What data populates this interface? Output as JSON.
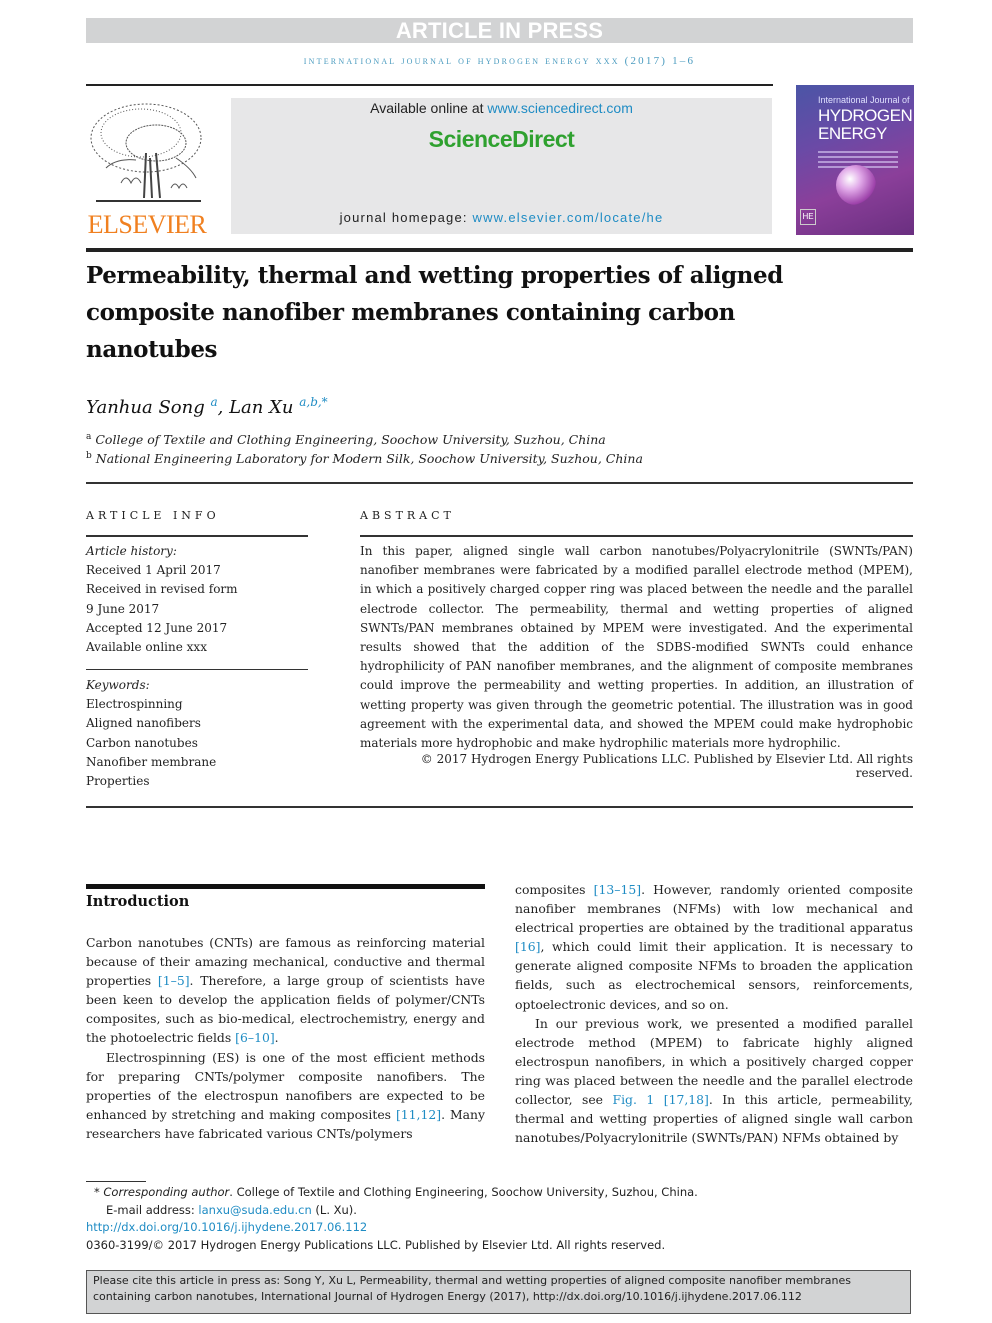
{
  "header": {
    "article_in_press": "ARTICLE IN PRESS",
    "journal_line": "International Journal of Hydrogen Energy xxx (2017) 1–6",
    "publisher_name": "ELSEVIER",
    "available_prefix": "Available online at ",
    "available_link": "www.sciencedirect.com",
    "brand": "ScienceDirect",
    "homepage_prefix": "journal homepage: ",
    "homepage_link": "www.elsevier.com/locate/he",
    "cover": {
      "title_small": "International Journal of",
      "title_line1": "HYDROGEN",
      "title_line2": "ENERGY",
      "badge": "HE"
    }
  },
  "article": {
    "title": "Permeability, thermal and wetting properties of aligned composite nanofiber membranes containing carbon nanotubes",
    "authors": [
      {
        "name": "Yanhua Song",
        "sup": "a"
      },
      {
        "name": "Lan Xu",
        "sup": "a,b,*"
      }
    ],
    "author_separator": ", ",
    "affiliations": [
      {
        "sup": "a",
        "text": "College of Textile and Clothing Engineering, Soochow University, Suzhou, China"
      },
      {
        "sup": "b",
        "text": "National Engineering Laboratory for Modern Silk, Soochow University, Suzhou, China"
      }
    ]
  },
  "article_info": {
    "label": "ARTICLE INFO",
    "history_label": "Article history:",
    "history": [
      "Received 1 April 2017",
      "Received in revised form",
      "9 June 2017",
      "Accepted 12 June 2017",
      "Available online xxx"
    ],
    "keywords_label": "Keywords:",
    "keywords": [
      "Electrospinning",
      "Aligned nanofibers",
      "Carbon nanotubes",
      "Nanofiber membrane",
      "Properties"
    ]
  },
  "abstract": {
    "label": "ABSTRACT",
    "text": "In this paper, aligned single wall carbon nanotubes/Polyacrylonitrile (SWNTs/PAN) nanofiber membranes were fabricated by a modified parallel electrode method (MPEM), in which a positively charged copper ring was placed between the needle and the parallel electrode collector. The permeability, thermal and wetting properties of aligned SWNTs/PAN membranes obtained by MPEM were investigated. And the experimental results showed that the addition of the SDBS-modified SWNTs could enhance hydrophilicity of PAN nanofiber membranes, and the alignment of composite membranes could improve the permeability and wetting properties. In addition, an illustration of wetting property was given through the geometric potential. The illustration was in good agreement with the experimental data, and showed the MPEM could make hydrophobic materials more hydrophobic and make hydrophilic materials more hydrophilic.",
    "copyright": "© 2017 Hydrogen Energy Publications LLC. Published by Elsevier Ltd. All rights reserved."
  },
  "introduction": {
    "heading": "Introduction",
    "left": {
      "p1": [
        {
          "t": "Carbon nanotubes (CNTs) are famous as reinforcing material because of their amazing mechanical, conductive and thermal properties "
        },
        {
          "ref": "[1–5]"
        },
        {
          "t": ". Therefore, a large group of scientists have been keen to develop the application fields of polymer/CNTs composites, such as bio-medical, electrochemistry, energy and the photoelectric fields "
        },
        {
          "ref": "[6–10]"
        },
        {
          "t": "."
        }
      ],
      "p2": [
        {
          "t": "Electrospinning (ES) is one of the most efficient methods for preparing CNTs/polymer composite nanofibers. The properties of the electrospun nanofibers are expected to be enhanced by stretching and making composites "
        },
        {
          "ref": "[11,12]"
        },
        {
          "t": ". Many researchers have fabricated various CNTs/polymers"
        }
      ]
    },
    "right": {
      "p1": [
        {
          "t": "composites "
        },
        {
          "ref": "[13–15]"
        },
        {
          "t": ". However, randomly oriented composite nanofiber membranes (NFMs) with low mechanical and electrical properties are obtained by the traditional apparatus "
        },
        {
          "ref": "[16]"
        },
        {
          "t": ", which could limit their application. It is necessary to generate aligned composite NFMs to broaden the application fields, such as electrochemical sensors, reinforcements, optoelectronic devices, and so on."
        }
      ],
      "p2": [
        {
          "t": "In our previous work, we presented a modified parallel electrode method (MPEM) to fabricate highly aligned electrospun nanofibers, in which a positively charged copper ring was placed between the needle and the parallel electrode collector, see "
        },
        {
          "ref": "Fig. 1"
        },
        {
          "t": " "
        },
        {
          "ref": "[17,18]"
        },
        {
          "t": ". In this article, permeability, thermal and wetting properties of aligned single wall carbon nanotubes/Polyacrylonitrile (SWNTs/PAN) NFMs obtained by"
        }
      ]
    }
  },
  "footnotes": {
    "star": "*",
    "corresponding_label": "Corresponding author",
    "corresponding_text": ". College of Textile and Clothing Engineering, Soochow University, Suzhou, China.",
    "email_label": "E-mail address: ",
    "email": "lanxu@suda.edu.cn",
    "email_suffix": " (L. Xu).",
    "doi": "http://dx.doi.org/10.1016/j.ijhydene.2017.06.112",
    "issn_line": "0360-3199/© 2017 Hydrogen Energy Publications LLC. Published by Elsevier Ltd. All rights reserved."
  },
  "citation_box": {
    "text": "Please cite this article in press as: Song Y, Xu L, Permeability, thermal and wetting properties of aligned composite nanofiber membranes containing carbon nanotubes, International Journal of Hydrogen Energy (2017), http://dx.doi.org/10.1016/j.ijhydene.2017.06.112"
  },
  "colors": {
    "link": "#1f8cc4",
    "elsevier_orange": "#f08020",
    "sciencedirect_green": "#2fa12f",
    "banner_gray": "#d2d3d4"
  }
}
